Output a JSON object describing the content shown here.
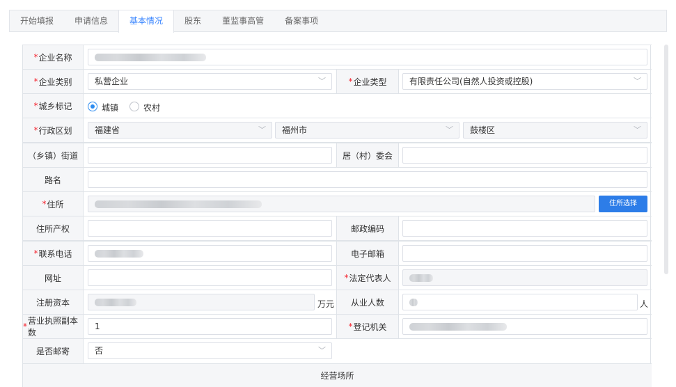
{
  "tabs": [
    {
      "label": "开始填报"
    },
    {
      "label": "申请信息"
    },
    {
      "label": "基本情况"
    },
    {
      "label": "股东"
    },
    {
      "label": "董监事高管"
    },
    {
      "label": "备案事项"
    }
  ],
  "form": {
    "company_name": {
      "label": "企业名称"
    },
    "company_category": {
      "label": "企业类别",
      "value": "私营企业"
    },
    "company_type": {
      "label": "企业类型",
      "value": "有限责任公司(自然人投资或控股)"
    },
    "urban_rural": {
      "label": "城乡标记",
      "options": [
        "城镇",
        "农村"
      ],
      "selected": "城镇"
    },
    "admin_region": {
      "label": "行政区划",
      "province": "福建省",
      "city": "福州市",
      "district": "鼓楼区"
    },
    "street": {
      "label": "（乡镇）街道"
    },
    "committee": {
      "label": "居（村）委会"
    },
    "road": {
      "label": "路名"
    },
    "address": {
      "label": "住所",
      "button": "住所选择"
    },
    "property_right": {
      "label": "住所产权"
    },
    "postcode": {
      "label": "邮政编码"
    },
    "phone": {
      "label": "联系电话"
    },
    "email": {
      "label": "电子邮箱"
    },
    "website": {
      "label": "网址"
    },
    "legal_rep": {
      "label": "法定代表人"
    },
    "reg_capital": {
      "label": "注册资本",
      "unit": "万元"
    },
    "employees": {
      "label": "从业人数",
      "unit": "人"
    },
    "license_copies": {
      "label": "营业执照副本数",
      "value": "1"
    },
    "reg_authority": {
      "label": "登记机关"
    },
    "mail_flag": {
      "label": "是否邮寄",
      "value": "否"
    },
    "section_title": "经营场所"
  },
  "icons": {
    "chevron": "chevron-down-icon"
  },
  "colors": {
    "accent": "#3a86ff",
    "required": "#f5222d",
    "button": "#2d7de8"
  }
}
